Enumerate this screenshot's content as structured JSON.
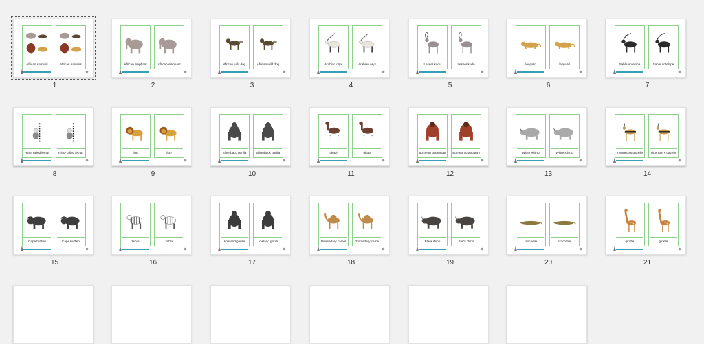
{
  "pages": [
    {
      "num": "1",
      "label": "African Animals",
      "animal": "group",
      "color": "#8a5a44",
      "selected": true
    },
    {
      "num": "2",
      "label": "African elephant",
      "animal": "elephant",
      "color": "#a89a95"
    },
    {
      "num": "3",
      "label": "African wild dog",
      "animal": "dog",
      "color": "#5b4a32"
    },
    {
      "num": "4",
      "label": "Arabian oryx",
      "animal": "oryx",
      "color": "#eae6de"
    },
    {
      "num": "5",
      "label": "Lesser kudu",
      "animal": "kudu",
      "color": "#9a8f93"
    },
    {
      "num": "6",
      "label": "leopard",
      "animal": "cat",
      "color": "#d4a24a"
    },
    {
      "num": "7",
      "label": "Sable antelope",
      "animal": "antelope",
      "color": "#2a2a2a"
    },
    {
      "num": "8",
      "label": "Ring-Tailed lemur",
      "animal": "lemur",
      "color": "#8a8a8a"
    },
    {
      "num": "9",
      "label": "lion",
      "animal": "lion",
      "color": "#d8a03c"
    },
    {
      "num": "10",
      "label": "Silverback gorilla",
      "animal": "gorilla",
      "color": "#4a4a4a"
    },
    {
      "num": "11",
      "label": "okapi",
      "animal": "okapi",
      "color": "#6b4030"
    },
    {
      "num": "12",
      "label": "Borneon orangutan",
      "animal": "orangutan",
      "color": "#a0402a"
    },
    {
      "num": "13",
      "label": "White Rhino",
      "animal": "rhino",
      "color": "#a9a9a9"
    },
    {
      "num": "14",
      "label": "Thomson's gazelle",
      "animal": "gazelle",
      "color": "#c99a52"
    },
    {
      "num": "15",
      "label": "Cape buffalo",
      "animal": "buffalo",
      "color": "#3e3e3e"
    },
    {
      "num": "16",
      "label": "zebra",
      "animal": "zebra",
      "color": "#555555"
    },
    {
      "num": "17",
      "label": "Lowland gorilla",
      "animal": "gorilla",
      "color": "#3c3c3c"
    },
    {
      "num": "18",
      "label": "Dromedary camel",
      "animal": "camel",
      "color": "#c08a4a"
    },
    {
      "num": "19",
      "label": "Black rhino",
      "animal": "rhino",
      "color": "#4a4440"
    },
    {
      "num": "20",
      "label": "crocodile",
      "animal": "croc",
      "color": "#8a7a40"
    },
    {
      "num": "21",
      "label": "giraffe",
      "animal": "giraffe",
      "color": "#c8823c"
    }
  ]
}
